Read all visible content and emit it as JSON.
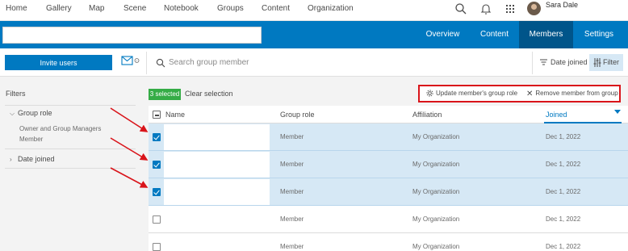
{
  "topnav": {
    "items": [
      "Home",
      "Gallery",
      "Map",
      "Scene",
      "Notebook",
      "Groups",
      "Content",
      "Organization"
    ],
    "icons": [
      "search-icon",
      "bell-icon",
      "apps-grid-icon"
    ],
    "user_name": "Sara Dale"
  },
  "group_header": {
    "tabs": [
      "Overview",
      "Content",
      "Members",
      "Settings"
    ],
    "active_tab": "Members"
  },
  "toolbar": {
    "invite_label": "Invite users",
    "mail_icon": "mail-icon",
    "search_placeholder": "Search group member",
    "sort_label": "Date joined",
    "filter_label": "Filter"
  },
  "sidebar": {
    "title": "Filters",
    "groups": [
      {
        "label": "Group role",
        "expanded": true,
        "options": [
          "Owner and Group Managers",
          "Member"
        ]
      },
      {
        "label": "Date joined",
        "expanded": false,
        "options": []
      }
    ]
  },
  "selection": {
    "badge": "3 selected",
    "clear_label": "Clear selection",
    "actions": [
      "Update member's group role",
      "Remove member from group"
    ]
  },
  "table": {
    "columns": [
      "Name",
      "Group role",
      "Affiliation",
      "Joined"
    ],
    "sorted_column": "Joined",
    "rows": [
      {
        "checked": true,
        "name": "",
        "role": "Member",
        "affiliation": "My Organization",
        "joined": "Dec 1, 2022"
      },
      {
        "checked": true,
        "name": "",
        "role": "Member",
        "affiliation": "My Organization",
        "joined": "Dec 1, 2022"
      },
      {
        "checked": true,
        "name": "",
        "role": "Member",
        "affiliation": "My Organization",
        "joined": "Dec 1, 2022"
      },
      {
        "checked": false,
        "name": "",
        "role": "Member",
        "affiliation": "My Organization",
        "joined": "Dec 1, 2022"
      },
      {
        "checked": false,
        "name": "",
        "role": "Member",
        "affiliation": "My Organization",
        "joined": "Dec 1, 2022"
      }
    ]
  },
  "colors": {
    "brand_blue": "#0079c1",
    "active_tab": "#00558a",
    "selected_row": "#d6e8f5",
    "badge_green": "#35ac46",
    "annotation_red": "#d9141a"
  }
}
